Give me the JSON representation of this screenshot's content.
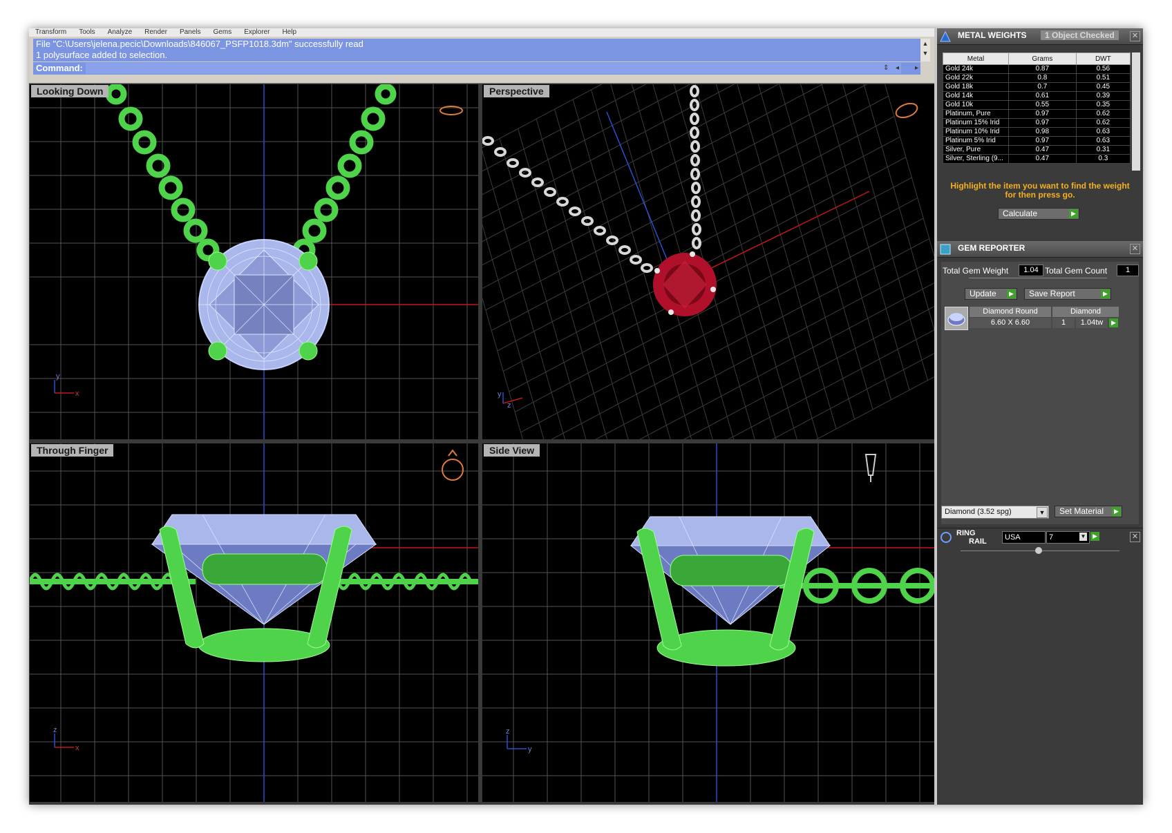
{
  "menu": [
    "Transform",
    "Tools",
    "Analyze",
    "Render",
    "Panels",
    "Gems",
    "Explorer",
    "Help"
  ],
  "command": {
    "history_line1": "File \"C:\\Users\\jelena.pecic\\Downloads\\846067_PSFP1018.3dm\" successfully read",
    "history_line2": "1 polysurface added to selection.",
    "label": "Command:",
    "value": ""
  },
  "viewports": {
    "top_left": {
      "label": "Looking Down",
      "axis_a": "y",
      "axis_b": "x"
    },
    "top_right": {
      "label": "Perspective",
      "axis_a": "y",
      "axis_b": "z"
    },
    "bottom_left": {
      "label": "Through Finger",
      "axis_a": "z",
      "axis_b": "x"
    },
    "bottom_right": {
      "label": "Side View",
      "axis_a": "z",
      "axis_b": "y"
    }
  },
  "metal_weights": {
    "title": "METAL WEIGHTS",
    "status": "1 Object Checked",
    "columns": [
      "Metal",
      "Grams",
      "DWT"
    ],
    "rows": [
      {
        "metal": "Gold 24k",
        "grams": "0.87",
        "dwt": "0.56"
      },
      {
        "metal": "Gold 22k",
        "grams": "0.8",
        "dwt": "0.51"
      },
      {
        "metal": "Gold 18k",
        "grams": "0.7",
        "dwt": "0.45"
      },
      {
        "metal": "Gold 14k",
        "grams": "0.61",
        "dwt": "0.39"
      },
      {
        "metal": "Gold 10k",
        "grams": "0.55",
        "dwt": "0.35"
      },
      {
        "metal": "Platinum, Pure",
        "grams": "0.97",
        "dwt": "0.62"
      },
      {
        "metal": "Platinum 15% Irid",
        "grams": "0.97",
        "dwt": "0.62"
      },
      {
        "metal": "Platinum 10% Irid",
        "grams": "0.98",
        "dwt": "0.63"
      },
      {
        "metal": "Platinum 5% Irid",
        "grams": "0.97",
        "dwt": "0.63"
      },
      {
        "metal": "Silver, Pure",
        "grams": "0.47",
        "dwt": "0.31"
      },
      {
        "metal": "Silver, Sterling (9...",
        "grams": "0.47",
        "dwt": "0.3"
      }
    ],
    "hint": "Highlight the item you want to find the weight for then press go.",
    "calculate_label": "Calculate"
  },
  "gem_reporter": {
    "title": "GEM REPORTER",
    "total_weight_label": "Total Gem Weight",
    "total_weight": "1.04",
    "total_count_label": "Total Gem Count",
    "total_count": "1",
    "update_label": "Update",
    "save_label": "Save Report",
    "gem": {
      "name": "Diamond Round",
      "material": "Diamond",
      "size": "6.60 X 6.60",
      "count": "1",
      "weight": "1.04tw"
    },
    "material_select": "Diamond      (3.52 spg)",
    "set_material_label": "Set Material"
  },
  "ring_rail": {
    "title_line1": "RING",
    "title_line2": "RAIL",
    "region": "USA",
    "size": "7"
  },
  "colors": {
    "metal_green": "#4fd34a",
    "gem_blue": "#aab8ee",
    "ruby": "#b0102a",
    "hint_orange": "#f5b021",
    "command_blue": "#7c95e2"
  }
}
